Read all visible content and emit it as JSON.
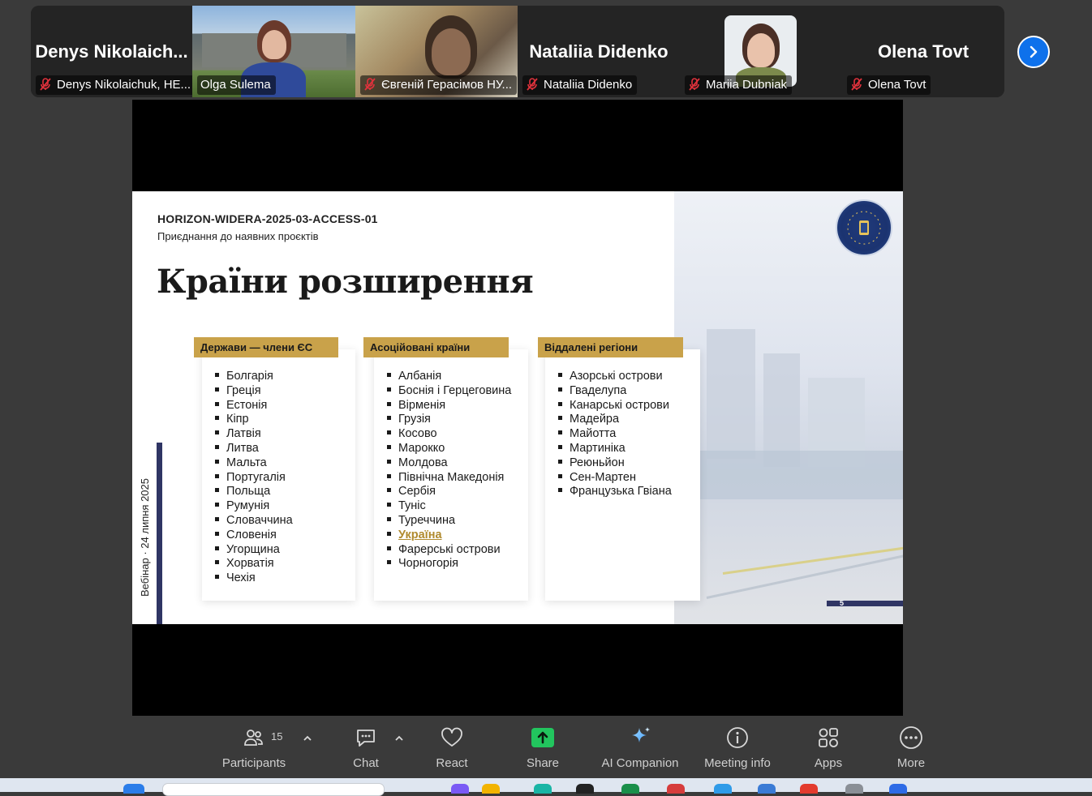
{
  "participants": [
    {
      "display_name": "Denys  Nikolaich...",
      "label": "Denys Nikolaichuk, HE...",
      "muted": true,
      "video": false
    },
    {
      "display_name": "",
      "label": "Olga Sulema",
      "muted": false,
      "video": true,
      "active_speaker": true
    },
    {
      "display_name": "",
      "label": "Євгеній Герасімов НУ...",
      "muted": true,
      "video": true
    },
    {
      "display_name": "Nataliia Didenko",
      "label": "Nataliia Didenko",
      "muted": true,
      "video": false
    },
    {
      "display_name": "",
      "label": "Mariia Dubniak",
      "muted": true,
      "video": false,
      "avatar": true
    },
    {
      "display_name": "Olena Tovt",
      "label": "Olena Tovt",
      "muted": true,
      "video": false
    }
  ],
  "slide": {
    "code": "HORIZON-WIDERA-2025-03-ACCESS-01",
    "subtitle": "Приєднання до наявних проєктів",
    "title": "Країни розширення",
    "vertical_text": "Вебінар · 24 липня 2025",
    "page_number": "5",
    "columns": [
      {
        "header": "Держави — члени ЄС",
        "items": [
          "Болгарія",
          "Греція",
          "Естонія",
          "Кіпр",
          "Латвія",
          "Литва",
          "Мальта",
          "Португалія",
          "Польща",
          "Румунія",
          "Словаччина",
          "Словенія",
          "Угорщина",
          "Хорватія",
          "Чехія"
        ]
      },
      {
        "header": "Асоційовані країни",
        "items": [
          "Албанія",
          "Боснія і Герцеговина",
          "Вірменія",
          "Грузія",
          "Косово",
          "Марокко",
          "Молдова",
          "Північна Македонія",
          "Сербія",
          "Туніс",
          "Туреччина",
          "Україна",
          "Фарерські острови",
          "Чорногорія"
        ],
        "highlight": "Україна"
      },
      {
        "header": "Віддалені регіони",
        "items": [
          "Азорські острови",
          "Гваделупа",
          "Канарські острови",
          "Мадейра",
          "Майотта",
          "Мартиніка",
          "Реюньйон",
          "Сен-Мартен",
          "Французька Гвіана"
        ]
      }
    ]
  },
  "toolbar": {
    "participants_label": "Participants",
    "participants_count": "15",
    "chat_label": "Chat",
    "react_label": "React",
    "share_label": "Share",
    "ai_label": "AI Companion",
    "info_label": "Meeting info",
    "apps_label": "Apps",
    "more_label": "More"
  },
  "colors": {
    "accent_gold": "#c9a24a",
    "active_speaker": "#3cd77e",
    "share_green": "#22c55e",
    "navy": "#2f3564",
    "zoom_blue": "#0e71eb"
  }
}
